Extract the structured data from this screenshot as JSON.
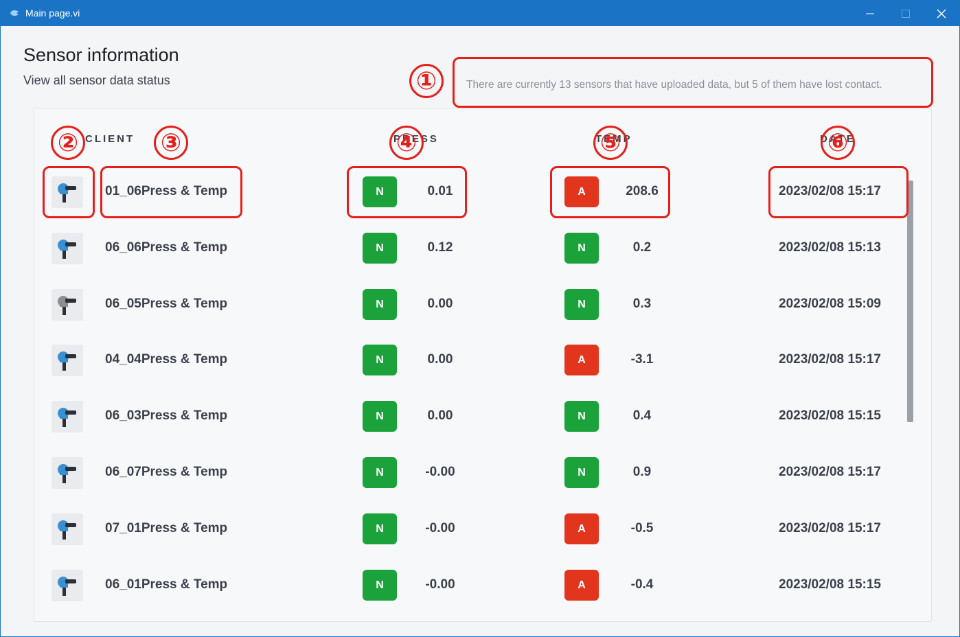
{
  "window": {
    "title": "Main page.vi",
    "minimize_label": "—",
    "maximize_label": "☐",
    "close_label": "✕"
  },
  "header": {
    "title": "Sensor information",
    "subtitle": "View all sensor data status",
    "notice": "There are currently 13 sensors that have uploaded data, but 5 of them have lost contact."
  },
  "table": {
    "columns": {
      "client": "CLIENT",
      "press": "PRESS",
      "temp": "TEMP",
      "date": "DATE"
    },
    "rows": [
      {
        "name": "01_06Press & Temp",
        "press_status": "N",
        "press_value": "0.01",
        "temp_status": "A",
        "temp_value": "208.6",
        "date": "2023/02/08 15:17",
        "icon": "sensor-blue"
      },
      {
        "name": "06_06Press & Temp",
        "press_status": "N",
        "press_value": "0.12",
        "temp_status": "N",
        "temp_value": "0.2",
        "date": "2023/02/08 15:13",
        "icon": "sensor-blue"
      },
      {
        "name": "06_05Press & Temp",
        "press_status": "N",
        "press_value": "0.00",
        "temp_status": "N",
        "temp_value": "0.3",
        "date": "2023/02/08 15:09",
        "icon": "sensor-gray"
      },
      {
        "name": "04_04Press & Temp",
        "press_status": "N",
        "press_value": "0.00",
        "temp_status": "A",
        "temp_value": "-3.1",
        "date": "2023/02/08 15:17",
        "icon": "sensor-blue"
      },
      {
        "name": "06_03Press & Temp",
        "press_status": "N",
        "press_value": "0.00",
        "temp_status": "N",
        "temp_value": "0.4",
        "date": "2023/02/08 15:15",
        "icon": "sensor-blue"
      },
      {
        "name": "06_07Press & Temp",
        "press_status": "N",
        "press_value": "-0.00",
        "temp_status": "N",
        "temp_value": "0.9",
        "date": "2023/02/08 15:17",
        "icon": "sensor-blue"
      },
      {
        "name": "07_01Press & Temp",
        "press_status": "N",
        "press_value": "-0.00",
        "temp_status": "A",
        "temp_value": "-0.5",
        "date": "2023/02/08 15:17",
        "icon": "sensor-blue"
      },
      {
        "name": "06_01Press & Temp",
        "press_status": "N",
        "press_value": "-0.00",
        "temp_status": "A",
        "temp_value": "-0.4",
        "date": "2023/02/08 15:15",
        "icon": "sensor-blue"
      }
    ]
  },
  "colors": {
    "titlebar": "#1a73c4",
    "normal": "#1ba23a",
    "alarm": "#e2351d",
    "annotation": "#e3201b"
  },
  "annotations": [
    "①",
    "②",
    "③",
    "④",
    "⑤",
    "⑥"
  ]
}
